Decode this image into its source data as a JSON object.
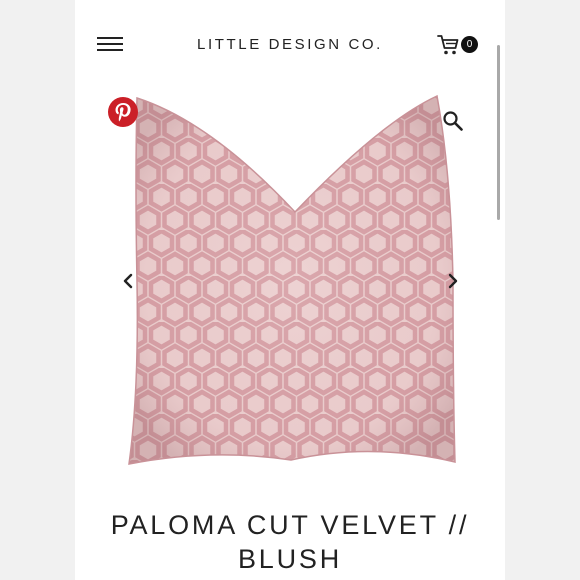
{
  "header": {
    "brand": "LITTLE DESIGN CO.",
    "cart_count": "0",
    "menu_icon": "hamburger-menu-icon",
    "cart_icon": "shopping-cart-icon"
  },
  "gallery": {
    "pinterest_icon": "pinterest-icon",
    "zoom_icon": "magnifier-zoom-icon",
    "prev_icon": "chevron-left-icon",
    "next_icon": "chevron-right-icon",
    "image_alt": "Blush pink cut velvet pillow with hexagon pattern"
  },
  "product": {
    "title_line1": "PALOMA CUT VELVET //",
    "title_line2": "BLUSH"
  },
  "colors": {
    "pinterest_red": "#cb1f27",
    "pillow_blush": "#dba8ad",
    "pattern_light": "#ecd0d0"
  }
}
